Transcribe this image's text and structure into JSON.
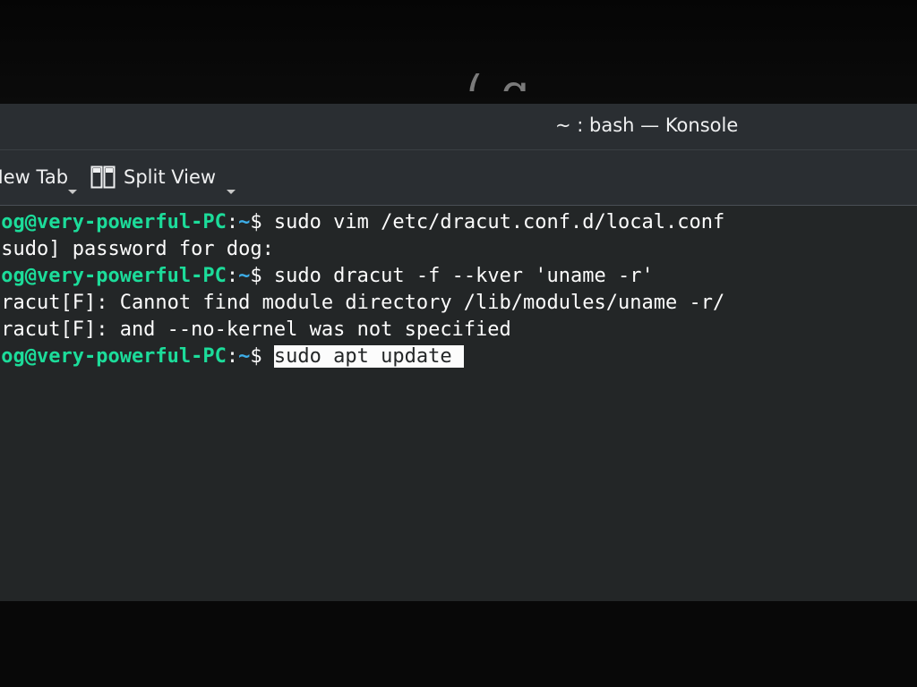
{
  "backdrop": {
    "fragment_text": "( g"
  },
  "window": {
    "title": "~ : bash — Konsole"
  },
  "toolbar": {
    "new_tab_label": "New Tab",
    "split_view_label": "Split View",
    "split_view_icon": "split-view-icon"
  },
  "terminal": {
    "lines": [
      {
        "prompt_user": "dog@very-powerful-PC",
        "prompt_sep": ":",
        "prompt_dir": "~",
        "prompt_symbol": "$ ",
        "command": "sudo vim /etc/dracut.conf.d/local.conf"
      },
      {
        "output": "[sudo] password for dog:"
      },
      {
        "prompt_user": "dog@very-powerful-PC",
        "prompt_sep": ":",
        "prompt_dir": "~",
        "prompt_symbol": "$ ",
        "command": "sudo dracut -f --kver 'uname -r'"
      },
      {
        "output": "dracut[F]: Cannot find module directory /lib/modules/uname -r/"
      },
      {
        "output": "dracut[F]: and --no-kernel was not specified"
      },
      {
        "prompt_user": "dog@very-powerful-PC",
        "prompt_sep": ":",
        "prompt_dir": "~",
        "prompt_symbol": "$ ",
        "input": "sudo apt update "
      }
    ]
  },
  "colors": {
    "terminal_bg": "#232627",
    "prompt_user": "#1cdc9a",
    "prompt_dir": "#3daee9",
    "text": "#fcfcfc"
  }
}
